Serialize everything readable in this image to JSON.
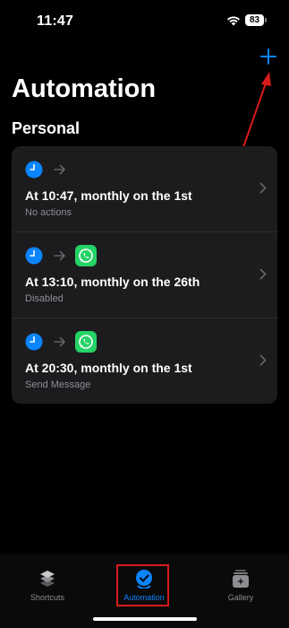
{
  "status_bar": {
    "time": "11:47",
    "battery": "83"
  },
  "header": {
    "add_icon": "plus-icon",
    "title": "Automation"
  },
  "section": {
    "title": "Personal"
  },
  "automations": [
    {
      "title": "At 10:47, monthly on the 1st",
      "subtitle": "No actions",
      "trigger_icon": "clock-icon",
      "action_icon": null
    },
    {
      "title": "At 13:10, monthly on the 26th",
      "subtitle": "Disabled",
      "trigger_icon": "clock-icon",
      "action_icon": "whatsapp-icon"
    },
    {
      "title": "At 20:30, monthly on the 1st",
      "subtitle": "Send Message",
      "trigger_icon": "clock-icon",
      "action_icon": "whatsapp-icon"
    }
  ],
  "tab_bar": {
    "tabs": [
      {
        "label": "Shortcuts",
        "icon": "stack-icon",
        "active": false
      },
      {
        "label": "Automation",
        "icon": "automation-clock-icon",
        "active": true
      },
      {
        "label": "Gallery",
        "icon": "gallery-icon",
        "active": false
      }
    ]
  },
  "colors": {
    "background": "#000000",
    "card": "#1c1c1e",
    "accent": "#0a84ff",
    "whatsapp": "#25d366",
    "annotation": "#d81b1b"
  }
}
